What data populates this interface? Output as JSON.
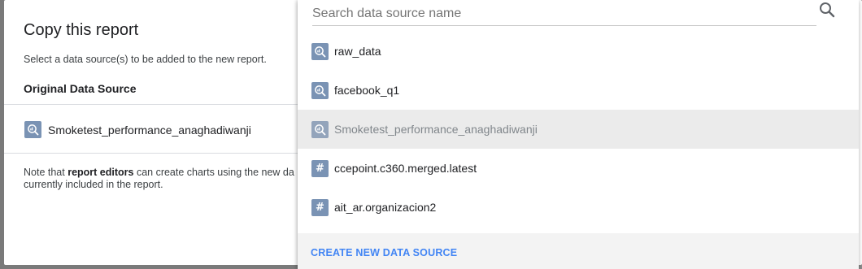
{
  "dialog": {
    "title": "Copy this report",
    "subtitle": "Select a data source(s) to be added to the new report.",
    "section_heading": "Original Data Source",
    "original_source": {
      "label": "Smoketest_performance_anaghadiwanji",
      "icon": "bigquery-icon"
    },
    "note": {
      "prefix": "Note that ",
      "bold": "report editors",
      "suffix": " can create charts using the new da",
      "line2": "currently included in the report."
    }
  },
  "dropdown": {
    "search": {
      "placeholder": "Search data source name",
      "value": ""
    },
    "items": [
      {
        "label": "raw_data",
        "icon": "bigquery-icon",
        "selected": false
      },
      {
        "label": "facebook_q1",
        "icon": "bigquery-icon",
        "selected": false
      },
      {
        "label": "Smoketest_performance_anaghadiwanji",
        "icon": "bigquery-icon",
        "selected": true
      },
      {
        "label": "ccepoint.c360.merged.latest",
        "icon": "hash-icon",
        "selected": false
      },
      {
        "label": "ait_ar.organizacion2",
        "icon": "hash-icon",
        "selected": false
      }
    ],
    "create_label": "CREATE NEW DATA SOURCE"
  },
  "colors": {
    "accent": "#4285f4",
    "icon_bg": "#7a93b4",
    "selected_row": "#ebebeb",
    "overlay": "#7a7a7a"
  }
}
